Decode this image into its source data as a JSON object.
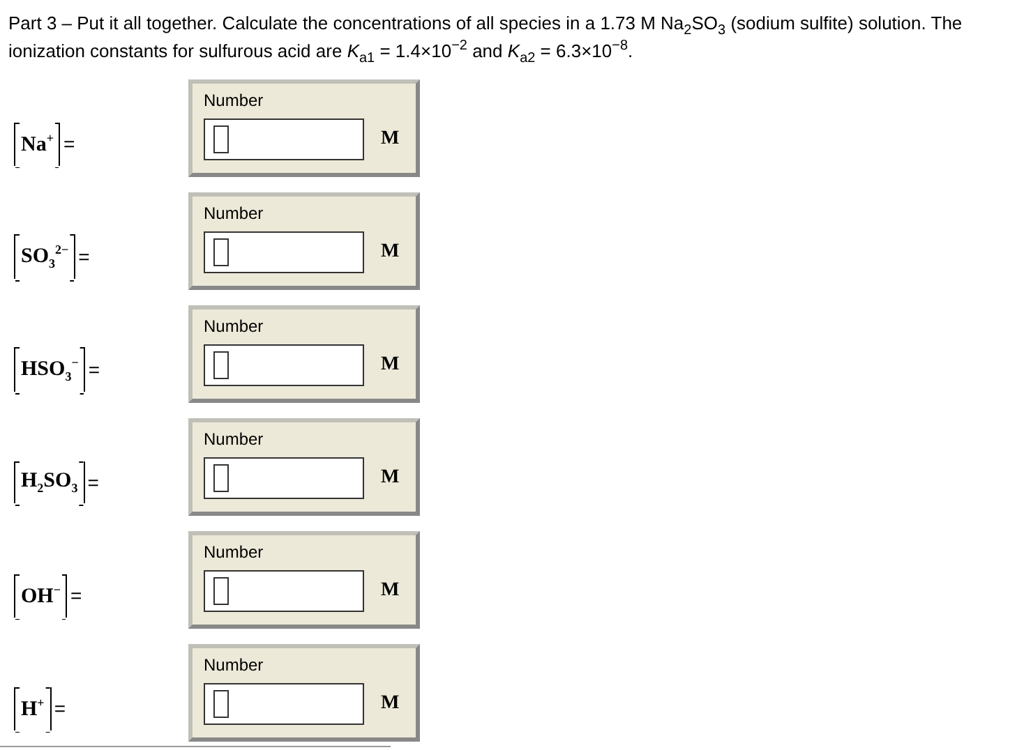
{
  "question": "Part 3 – Put it all together. Calculate the concentrations of all species in a 1.73  M Na$_{2}$SO$_{3}$ (sodium sulfite) solution. The ionization constants for sulfurous acid are *K*$_{a1}$ = 1.4×10$^{−2}$ and *K*$_{a2}$ = 6.3×10$^{−8}$.",
  "answers": [
    {
      "species": "Na$^{+}$",
      "equals": "=",
      "field_label": "Number",
      "unit": "M"
    },
    {
      "species": "SO$_{3}$$^{2−}$",
      "equals": "=",
      "field_label": "Number",
      "unit": "M"
    },
    {
      "species": "HSO$_{3}$$^{−}$",
      "equals": "=",
      "field_label": "Number",
      "unit": "M"
    },
    {
      "species": "H$_{2}$SO$_{3}$",
      "equals": "=",
      "field_label": "Number",
      "unit": "M"
    },
    {
      "species": "OH$^{−}$",
      "equals": "=",
      "field_label": "Number",
      "unit": "M"
    },
    {
      "species": "H$^{+}$",
      "equals": "=",
      "field_label": "Number",
      "unit": "M"
    }
  ]
}
